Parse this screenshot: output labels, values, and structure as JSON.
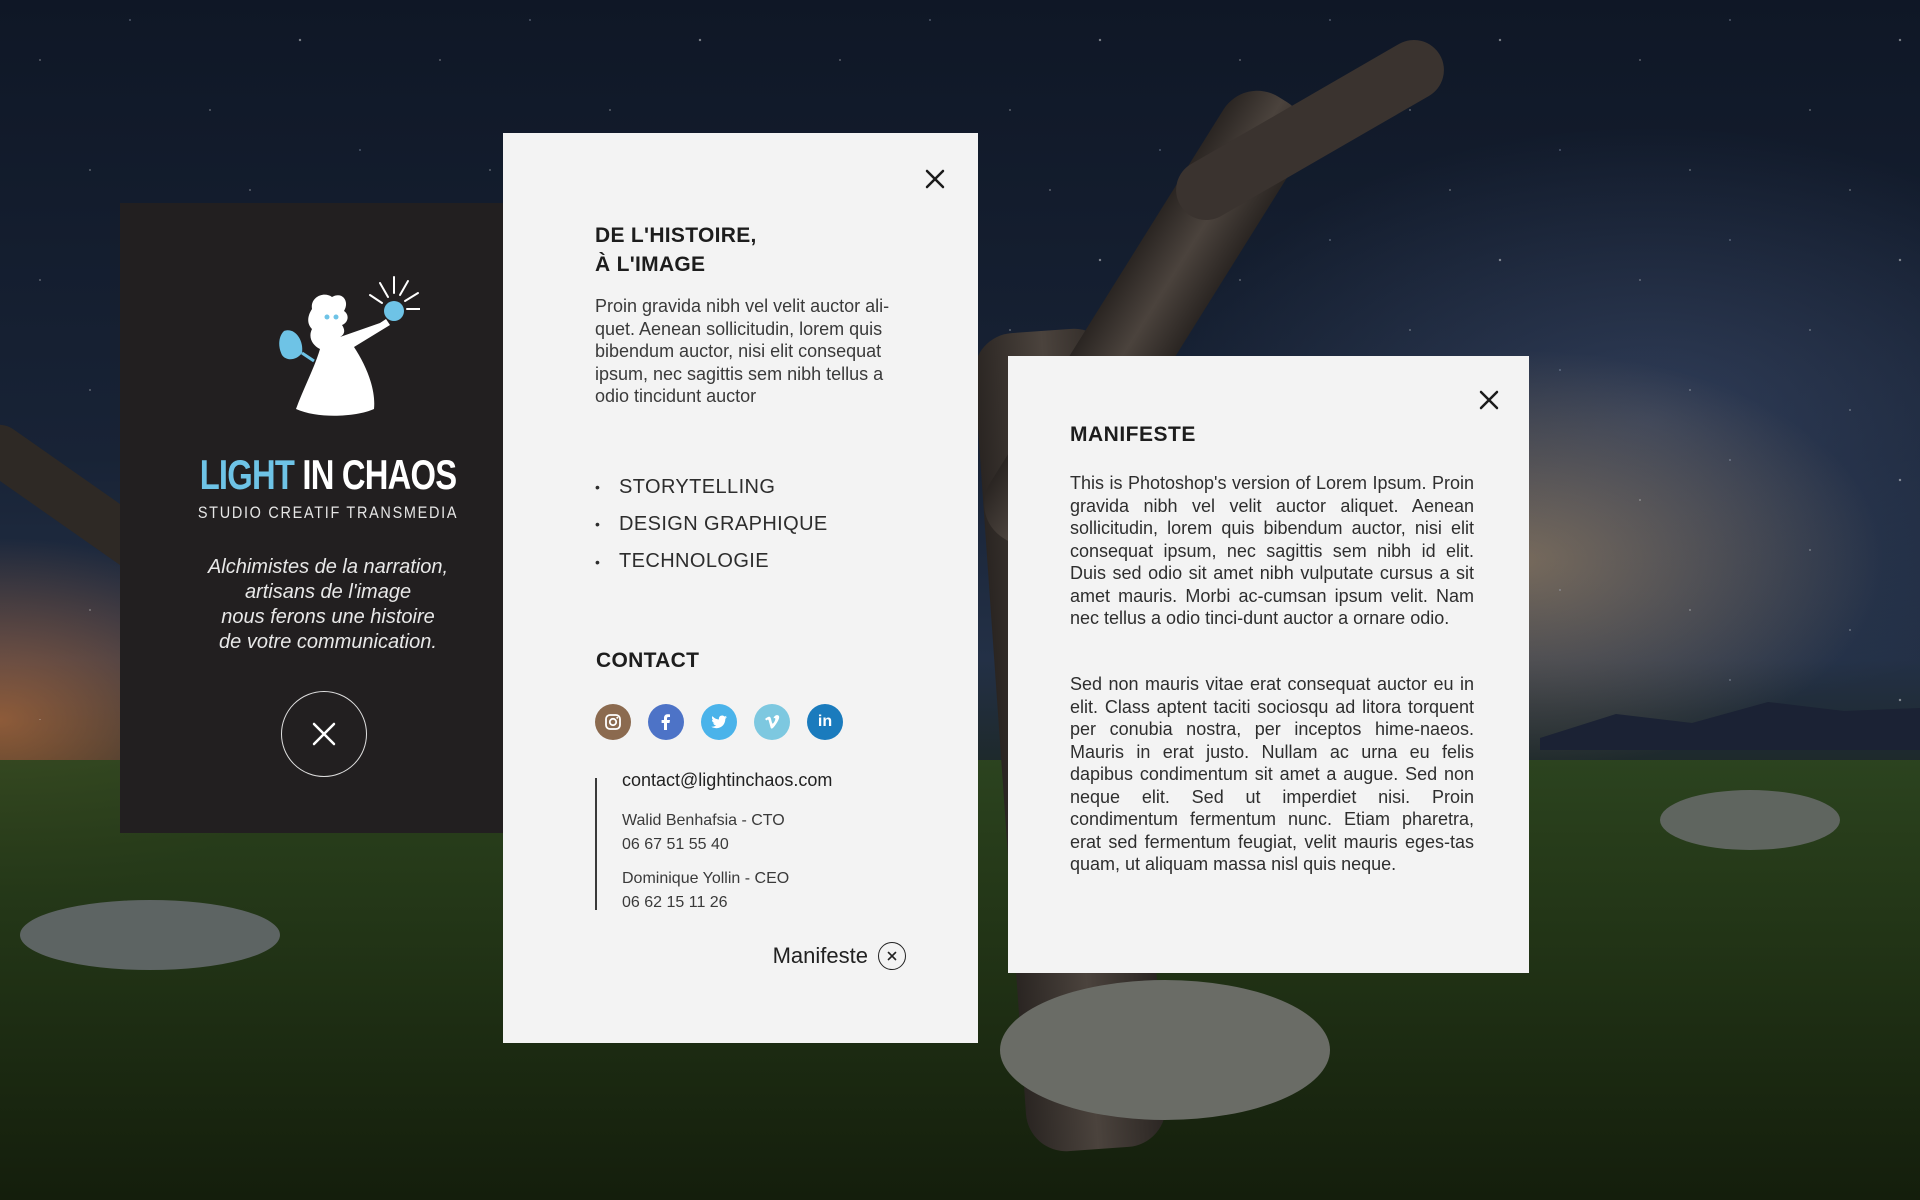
{
  "brand": {
    "name_light": "LIGHT",
    "name_rest": " IN CHAOS",
    "tagline": "STUDIO CREATIF TRANSMEDIA",
    "slogan": [
      "Alchimistes de la narration,",
      "artisans de l'image",
      "nous ferons une histoire",
      "de votre communication."
    ],
    "accent_color": "#6ec3e6",
    "logo_icon": "wizard-holding-light-orb"
  },
  "info": {
    "title_line1": "DE L'HISTOIRE,",
    "title_line2": "À L'IMAGE",
    "intro": "Proin gravida nibh vel velit auctor ali-quet. Aenean sollicitudin, lorem quis bibendum auctor, nisi elit consequat ipsum, nec sagittis sem nibh tellus a odio tincidunt auctor",
    "services": [
      "STORYTELLING",
      "DESIGN GRAPHIQUE",
      "TECHNOLOGIE"
    ],
    "contact_title": "CONTACT",
    "socials": [
      {
        "name": "instagram",
        "icon": "instagram-icon",
        "color": "#8b6a4f"
      },
      {
        "name": "facebook",
        "icon": "facebook-icon",
        "color": "#4d73c7"
      },
      {
        "name": "twitter",
        "icon": "twitter-icon",
        "color": "#4ab3ea"
      },
      {
        "name": "vimeo",
        "icon": "vimeo-icon",
        "color": "#7dc8e0"
      },
      {
        "name": "linkedin",
        "icon": "linkedin-icon",
        "color": "#1a7bbd"
      }
    ],
    "email": "contact@lightinchaos.com",
    "people": [
      {
        "role": "Walid Benhafsia - CTO",
        "phone": "06 67 51 55 40"
      },
      {
        "role": "Dominique Yollin - CEO",
        "phone": "06 62 15 11 26"
      }
    ],
    "manifeste_link": "Manifeste"
  },
  "manifesto": {
    "title": "MANIFESTE",
    "paragraph1": "This is Photoshop's version  of Lorem Ipsum. Proin gravida nibh vel velit auctor aliquet. Aenean sollicitudin, lorem quis bibendum auctor, nisi elit consequat ipsum, nec sagittis sem nibh id elit. Duis sed odio sit amet nibh vulputate cursus a sit amet mauris. Morbi ac-cumsan ipsum velit. Nam nec tellus a odio tinci-dunt auctor a ornare odio.",
    "paragraph2": "Sed non  mauris vitae erat consequat auctor eu in elit. Class aptent taciti sociosqu ad litora torquent per conubia nostra, per inceptos hime-naeos. Mauris in erat justo. Nullam ac urna eu felis dapibus condimentum sit amet a augue. Sed non neque elit. Sed ut imperdiet nisi. Proin condimentum fermentum nunc. Etiam pharetra, erat sed fermentum feugiat, velit mauris eges-tas quam, ut aliquam massa nisl quis neque."
  }
}
